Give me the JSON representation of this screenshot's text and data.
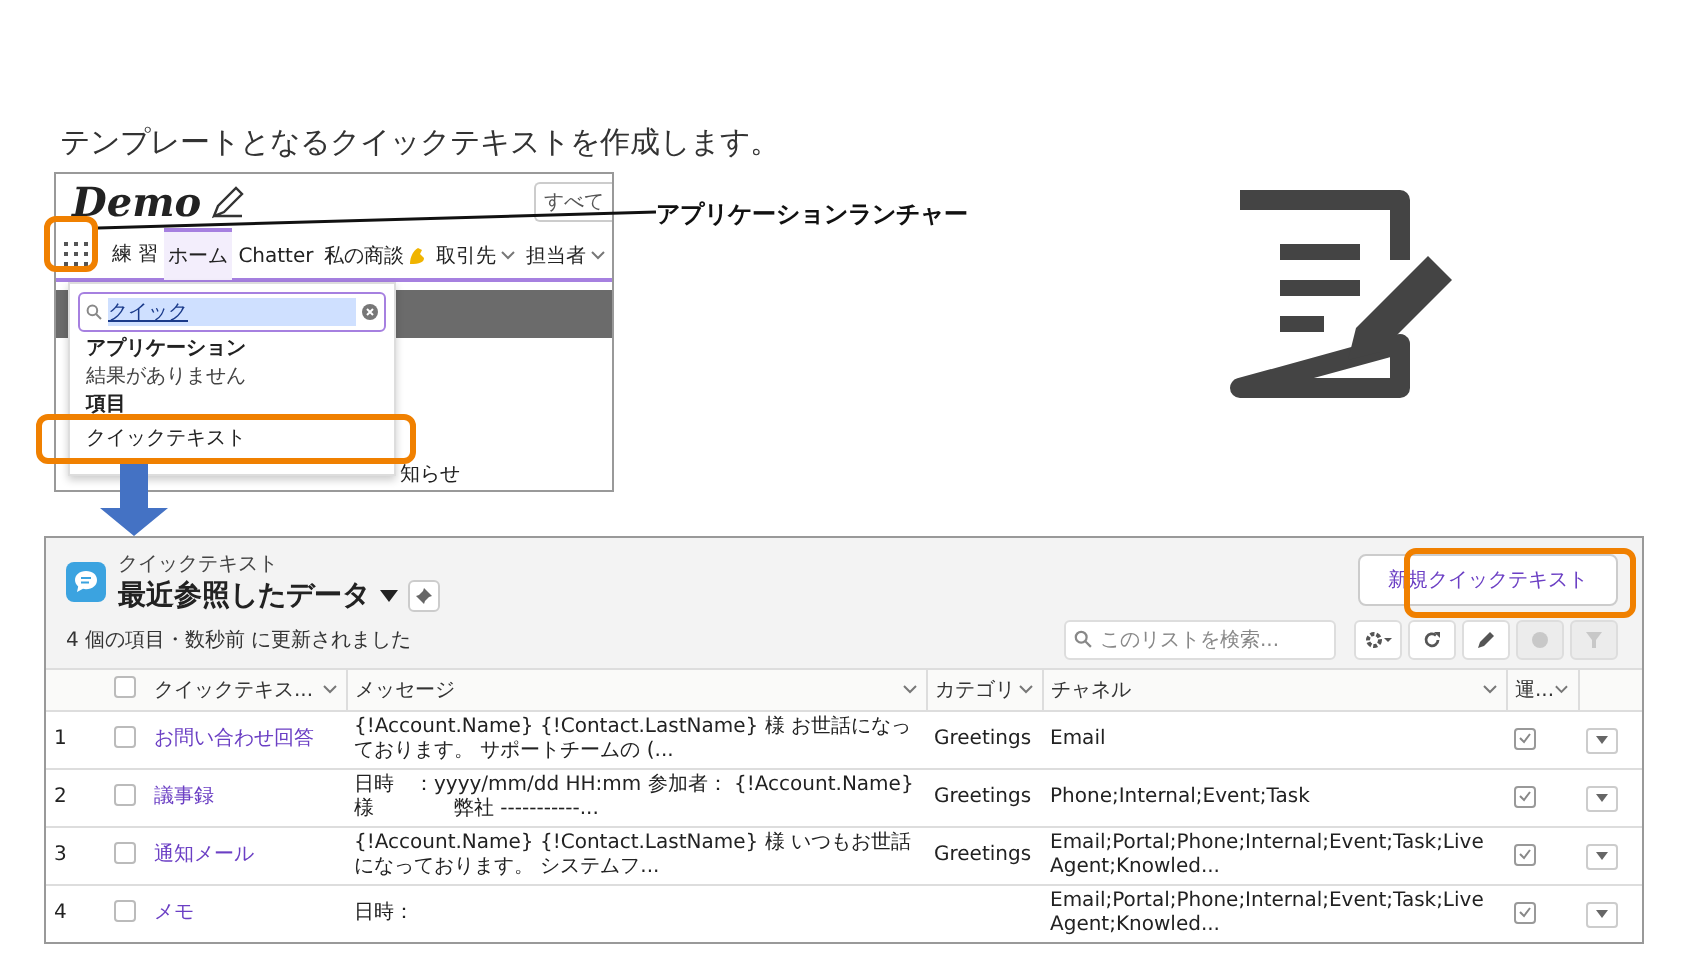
{
  "title": "テンプレートとなるクイックテキストを作成します。",
  "callout": "アプリケーションランチャー",
  "launcher_screenshot": {
    "logo": "Demo",
    "search_scope": "すべて",
    "app_name": "練 習",
    "nav": [
      {
        "label": "ホーム",
        "selected": true,
        "menu": false
      },
      {
        "label": "Chatter",
        "selected": false,
        "menu": false
      },
      {
        "label": "私の商談",
        "selected": false,
        "menu": false,
        "kind": "emoji"
      },
      {
        "label": "取引先",
        "selected": false,
        "menu": true
      },
      {
        "label": "担当者",
        "selected": false,
        "menu": true
      }
    ],
    "search_value": "クイック",
    "sections": [
      {
        "heading": "アプリケーション",
        "items": [
          {
            "label": "結果がありません",
            "kind": "empty"
          }
        ]
      },
      {
        "heading": "項目",
        "items": [
          {
            "label": "クイックテキスト",
            "kind": "item"
          }
        ]
      }
    ],
    "background_text": "知らせ"
  },
  "list_view": {
    "object_label": "クイックテキスト",
    "view_name": "最近参照したデータ",
    "new_button": "新規クイックテキスト",
    "all_selected": false,
    "status": "4 個の項目・数秒前 に更新されました",
    "search_placeholder": "このリストを検索...",
    "tools": [
      {
        "kind": "settings",
        "disabled": false
      },
      {
        "kind": "refresh",
        "disabled": false
      },
      {
        "kind": "edit",
        "disabled": false
      },
      {
        "kind": "chart",
        "disabled": true
      },
      {
        "kind": "filter",
        "disabled": true
      }
    ],
    "columns": [
      "クイックテキス...",
      "メッセージ",
      "カテゴリ",
      "チャネル",
      "運..."
    ],
    "rows": [
      {
        "number": "1",
        "selected": false,
        "name": "お問い合わせ回答",
        "message": "{!Account.Name} {!Contact.LastName} 様 お世話になっております。 サポートチームの (...",
        "category": "Greetings",
        "channel": "Email",
        "active": true
      },
      {
        "number": "2",
        "selected": false,
        "name": "議事録",
        "message": "日時　：yyyy/mm/dd HH:mm 参加者： {!Account.Name} 様　　　　弊社 -----------...",
        "category": "Greetings",
        "channel": "Phone;Internal;Event;Task",
        "active": true
      },
      {
        "number": "3",
        "selected": false,
        "name": "通知メール",
        "message": "{!Account.Name} {!Contact.LastName} 様 いつもお世話になっております。 システムフ...",
        "category": "Greetings",
        "channel": "Email;Portal;Phone;Internal;Event;Task;Live Agent;Knowled...",
        "active": true
      },
      {
        "number": "4",
        "selected": false,
        "name": "メモ",
        "message": "日時：",
        "channel": "Email;Portal;Phone;Internal;Event;Task;Live Agent;Knowled...",
        "active": true
      }
    ]
  }
}
